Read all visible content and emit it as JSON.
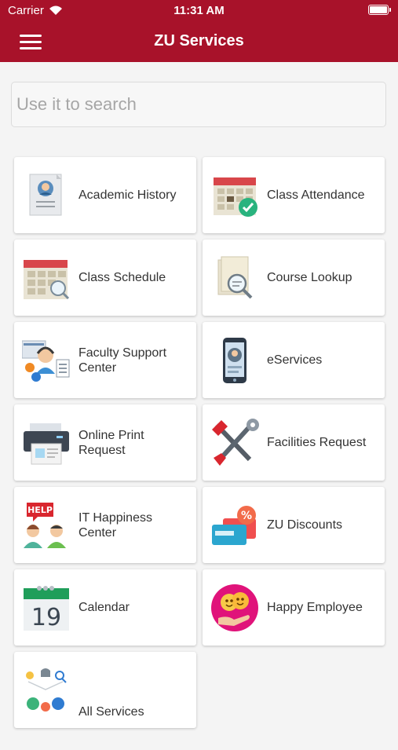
{
  "status": {
    "carrier": "Carrier",
    "time": "11:31 AM"
  },
  "header": {
    "title": "ZU Services"
  },
  "search": {
    "placeholder": "Use it to search"
  },
  "services": [
    {
      "label": "Academic History",
      "icon": "academic-history-icon"
    },
    {
      "label": "Class Attendance",
      "icon": "class-attendance-icon"
    },
    {
      "label": "Class Schedule",
      "icon": "class-schedule-icon"
    },
    {
      "label": "Course Lookup",
      "icon": "course-lookup-icon"
    },
    {
      "label": "Faculty Support Center",
      "icon": "faculty-support-icon"
    },
    {
      "label": "eServices",
      "icon": "eservices-icon"
    },
    {
      "label": "Online Print Request",
      "icon": "printer-icon"
    },
    {
      "label": "Facilities Request",
      "icon": "tools-icon"
    },
    {
      "label": "IT Happiness Center",
      "icon": "help-desk-icon"
    },
    {
      "label": "ZU Discounts",
      "icon": "discount-card-icon"
    },
    {
      "label": "Calendar",
      "icon": "calendar-icon"
    },
    {
      "label": "Happy Employee",
      "icon": "happy-employee-icon"
    },
    {
      "label": "All Services",
      "icon": "all-services-icon"
    }
  ],
  "calendar_icon_day": "19",
  "help_icon_text": "HELP",
  "colors": {
    "brand": "#a8122a",
    "background": "#f4f4f4",
    "tile": "#ffffff"
  }
}
